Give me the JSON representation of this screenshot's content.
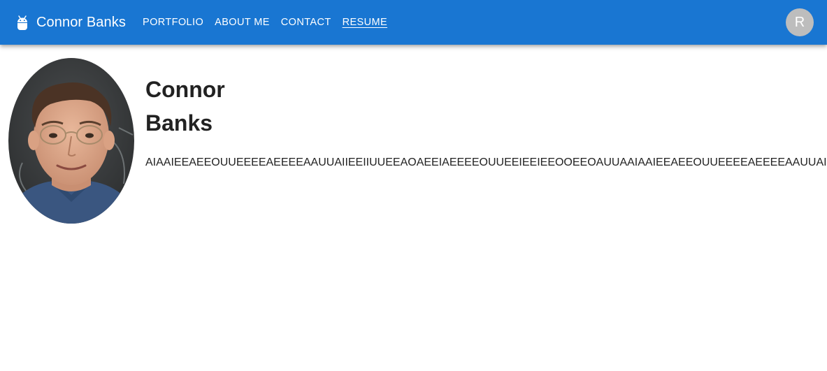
{
  "appbar": {
    "brand_icon": "android-icon",
    "title": "Connor Banks",
    "nav": [
      {
        "label": "PORTFOLIO",
        "active": false
      },
      {
        "label": "ABOUT ME",
        "active": false
      },
      {
        "label": "CONTACT",
        "active": false
      },
      {
        "label": "RESUME",
        "active": true
      }
    ],
    "avatar_initial": "R",
    "colors": {
      "bar": "#1976d2",
      "avatar": "#bdbdbd"
    }
  },
  "profile": {
    "first_name": "Connor",
    "last_name": "Banks",
    "bio": "AIAAIEEAEEOUUEEEEAEEEEAAUUAIIEEIIUUEEAOAEEIAEEEEOUUEEIEEIEEOOEEOAUUAAIAAIEEAEEOUUEEEEAEEEEAAUUAIIEE"
  }
}
